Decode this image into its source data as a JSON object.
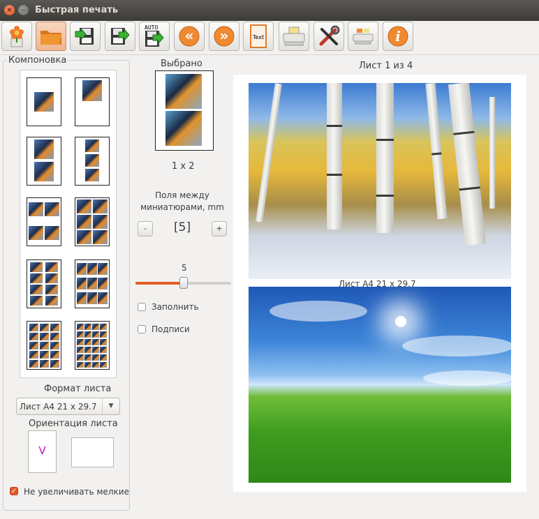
{
  "window": {
    "title": "Быстрая печать",
    "close_glyph": "×",
    "minimize_glyph": "–"
  },
  "toolbar": {
    "buttons": [
      {
        "name": "flower-icon"
      },
      {
        "name": "folder-icon"
      },
      {
        "name": "save-in-icon"
      },
      {
        "name": "save-out-icon"
      },
      {
        "name": "auto-save-icon",
        "label": "AUTO"
      },
      {
        "name": "prev-page-icon",
        "glyph": "«"
      },
      {
        "name": "next-page-icon",
        "glyph": "»"
      },
      {
        "name": "text-icon",
        "label": "Text"
      },
      {
        "name": "printer-icon"
      },
      {
        "name": "tools-icon"
      },
      {
        "name": "print-settings-icon"
      },
      {
        "name": "info-icon",
        "glyph": "i"
      }
    ]
  },
  "layout_group": {
    "label": "Компоновка"
  },
  "format": {
    "label": "Формат листа",
    "value": "Лист А4 21 x 29.7",
    "arrow": "▼"
  },
  "orientation": {
    "label": "Ориентация листа",
    "portrait_mark": "V"
  },
  "options": {
    "no_enlarge_label": "Не увеличивать мелкие",
    "no_enlarge_checked": true,
    "check_glyph": "✓"
  },
  "selected": {
    "label": "Выбрано",
    "grid": "1 x 2"
  },
  "spacing": {
    "label": "Поля между миниатюрами, mm",
    "value": "[5]",
    "minus": "-",
    "plus": "+",
    "slider_value": "5",
    "slider_fraction": 0.5
  },
  "checkboxes": {
    "fill_label": "Заполнить",
    "captions_label": "Подписи"
  },
  "preview": {
    "page_label": "Лист 1 из 4",
    "sheet_name": "Лист А4 21 x 29.7"
  },
  "colors": {
    "accent": "#e25b25",
    "titlebar": "#3c3b37"
  }
}
